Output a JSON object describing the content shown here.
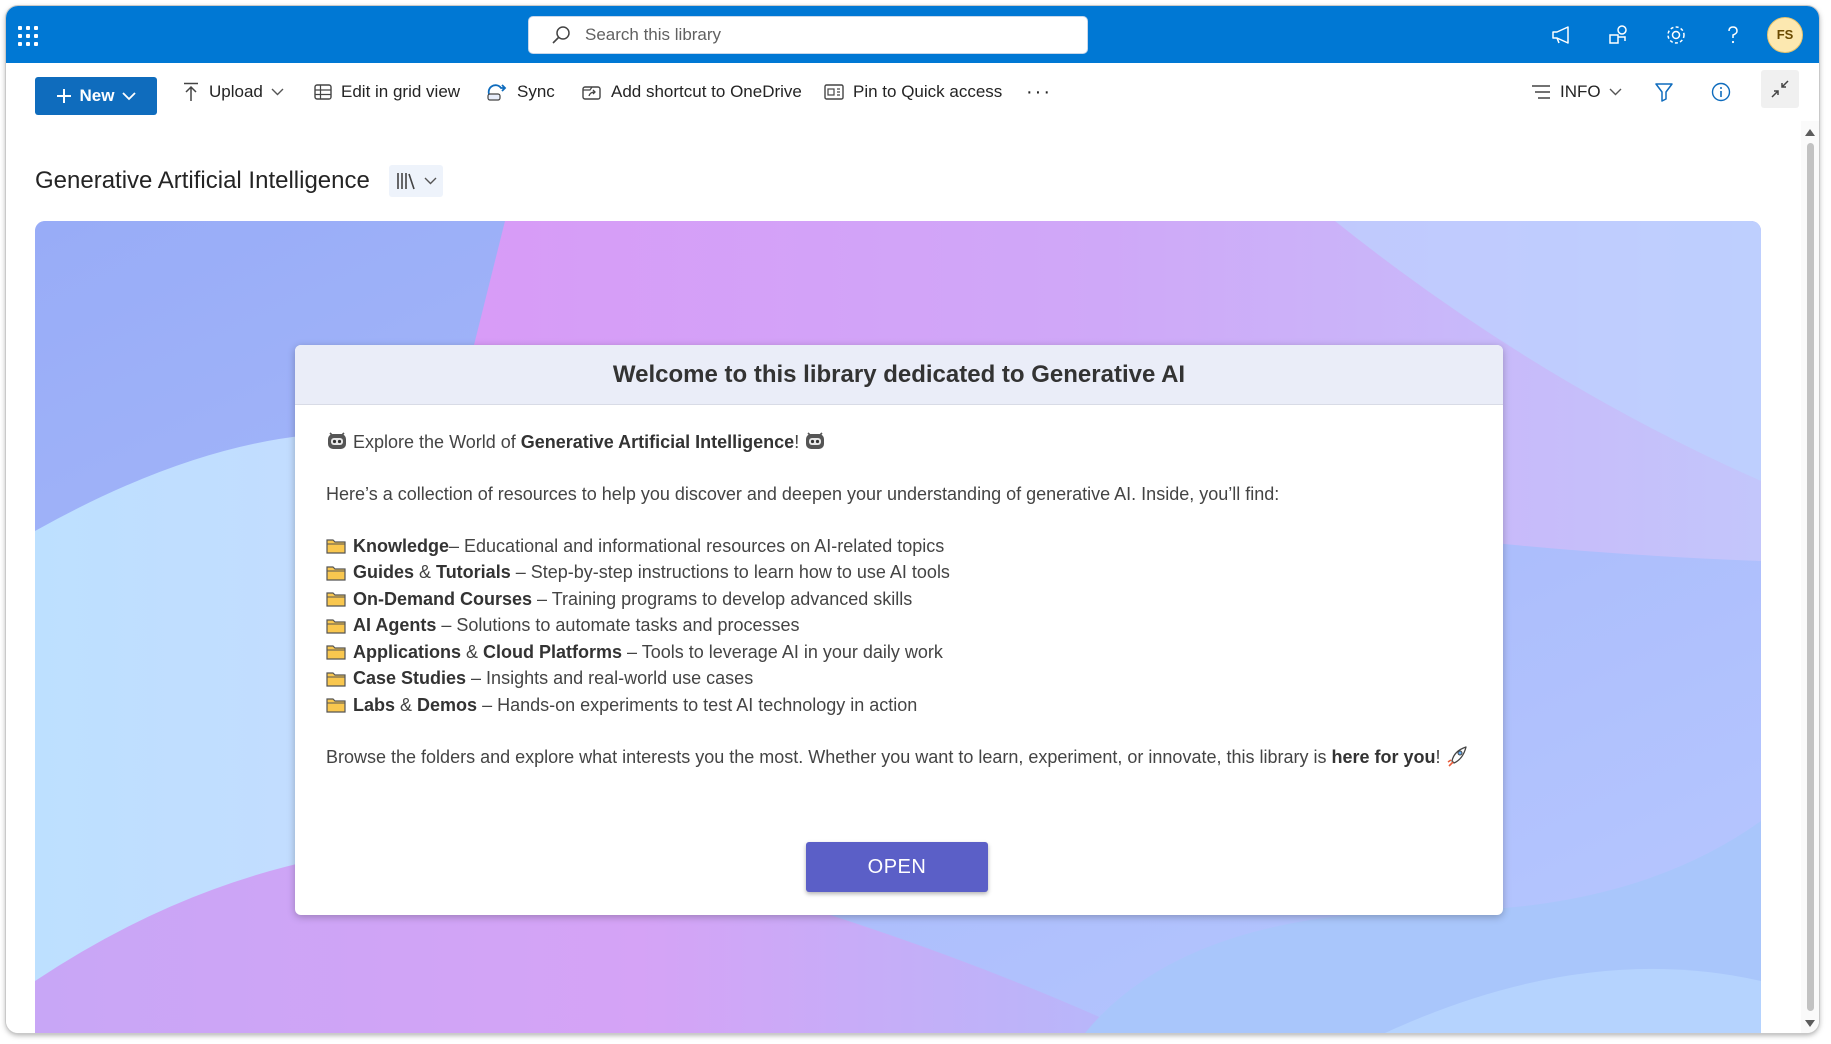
{
  "suitebar": {
    "search_placeholder": "Search this library",
    "avatar_initials": "FS",
    "accent_color": "#0078d4"
  },
  "commandbar": {
    "new_label": "New",
    "upload_label": "Upload",
    "grid_label": "Edit in grid view",
    "sync_label": "Sync",
    "shortcut_label": "Add shortcut to OneDrive",
    "pin_label": "Pin to Quick access",
    "more_label": "···",
    "view_label": "INFO"
  },
  "library": {
    "title": "Generative Artificial Intelligence"
  },
  "card": {
    "heading": "Welcome to this library dedicated to Generative AI",
    "intro_prefix": "Explore the World of ",
    "intro_bold": "Generative Artificial Intelligence",
    "intro_suffix": "!",
    "description": "Here’s a collection of resources to help you discover and deepen your understanding of generative AI. Inside, you’ll find:",
    "items": [
      {
        "bold1": "Knowledge",
        "amp": "",
        "bold2": "",
        "desc": " – Educational and informational resources on AI-related topics"
      },
      {
        "bold1": "Guides",
        "amp": " & ",
        "bold2": "Tutorials",
        "desc": " – Step-by-step instructions to learn how to use AI tools"
      },
      {
        "bold1": "On-Demand Courses",
        "amp": "",
        "bold2": "",
        "desc": " – Training programs to develop advanced skills"
      },
      {
        "bold1": "AI Agents",
        "amp": "",
        "bold2": "",
        "desc": " – Solutions to automate tasks and processes"
      },
      {
        "bold1": "Applications",
        "amp": " & ",
        "bold2": "Cloud Platforms",
        "desc": " – Tools to leverage AI in your daily work"
      },
      {
        "bold1": "Case Studies",
        "amp": "",
        "bold2": "",
        "desc": " – Insights and real-world use cases"
      },
      {
        "bold1": "Labs",
        "amp": " & ",
        "bold2": "Demos",
        "desc": " – Hands-on experiments to test AI technology in action"
      }
    ],
    "closing_text": "Browse the folders and explore what interests you the most. Whether you want to learn, experiment, or innovate, this library is ",
    "closing_bold": "here for you",
    "closing_suffix": "!",
    "button_label": "OPEN",
    "button_color": "#5b5fc7"
  }
}
